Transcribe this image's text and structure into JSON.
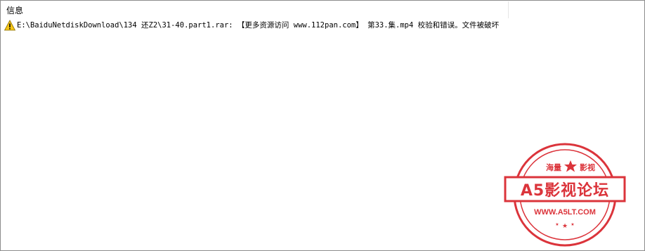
{
  "header": {
    "column_label": "信息"
  },
  "rows": [
    {
      "icon": "warning-icon",
      "message": "E:\\BaiduNetdiskDownload\\134 还Z2\\31-40.part1.rar: 【更多资源访问 www.112pan.com】 第33.集.mp4 校验和错误。文件被破坏"
    }
  ],
  "watermark": {
    "top_left": "海量",
    "top_right": "影视",
    "main": "A5影视论坛",
    "url": "WWW.A5LT.COM",
    "color": "#d9232b"
  }
}
